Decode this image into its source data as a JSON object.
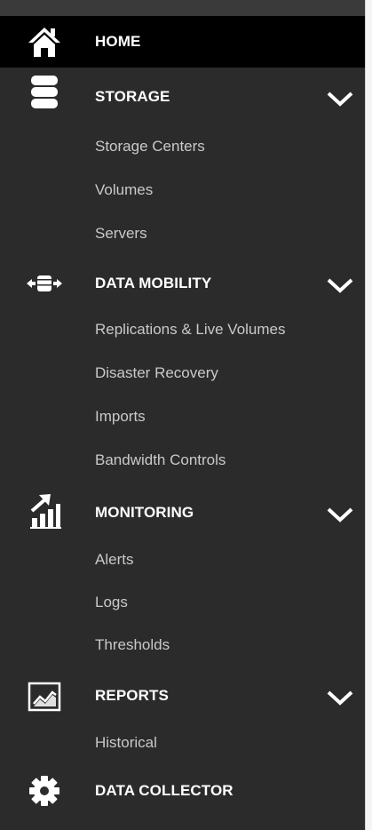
{
  "sidebar": {
    "home": {
      "label": "HOME",
      "icon": "home-icon"
    },
    "storage": {
      "label": "STORAGE",
      "icon": "database-icon",
      "items": [
        "Storage Centers",
        "Volumes",
        "Servers"
      ]
    },
    "data_mobility": {
      "label": "DATA MOBILITY",
      "icon": "data-transfer-icon",
      "items": [
        "Replications & Live Volumes",
        "Disaster Recovery",
        "Imports",
        "Bandwidth Controls"
      ]
    },
    "monitoring": {
      "label": "MONITORING",
      "icon": "bar-chart-trend-icon",
      "items": [
        "Alerts",
        "Logs",
        "Thresholds"
      ]
    },
    "reports": {
      "label": "REPORTS",
      "icon": "line-chart-icon",
      "items": [
        "Historical"
      ]
    },
    "data_collector": {
      "label": "DATA COLLECTOR",
      "icon": "gear-icon"
    }
  },
  "colors": {
    "sidebar_bg": "#2b2b2b",
    "active_bg": "#000000",
    "label": "#ffffff",
    "subitem": "#c9c9c9"
  }
}
